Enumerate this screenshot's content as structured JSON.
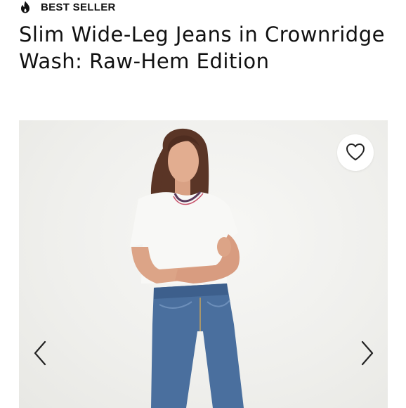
{
  "badge": {
    "icon": "flame-icon",
    "label": "BEST SELLER"
  },
  "product": {
    "title": "Slim Wide-Leg Jeans in Crownridge Wash: Raw-Hem Edition"
  },
  "gallery": {
    "image": "model wearing jeans and white tee",
    "favorite_icon": "heart-icon",
    "prev_icon": "chevron-left-icon",
    "next_icon": "chevron-right-icon"
  },
  "colors": {
    "text": "#111111",
    "background": "#ffffff",
    "gallery_bg": "#f1f1ef",
    "denim": "#4a6f9e"
  }
}
